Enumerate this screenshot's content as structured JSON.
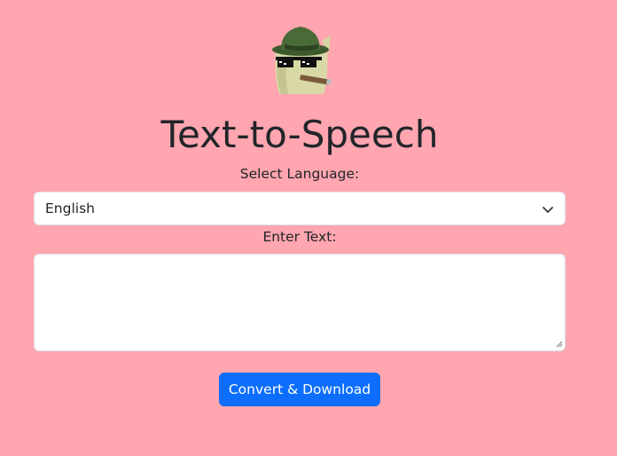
{
  "page": {
    "background_color": "#ffa6b0",
    "title": "Text-to-Speech",
    "mascot_icon": "cat-with-fedora-and-sunglasses-icon"
  },
  "language": {
    "label": "Select Language:",
    "selected": "English"
  },
  "text_input": {
    "label": "Enter Text:",
    "value": ""
  },
  "actions": {
    "convert_label": "Convert & Download",
    "button_color": "#0d6efd"
  }
}
